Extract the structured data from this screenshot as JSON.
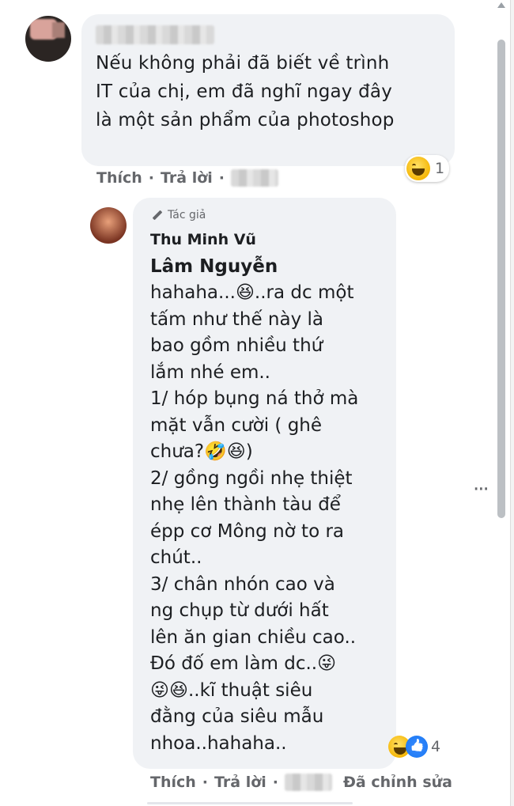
{
  "comment1": {
    "author": "",
    "text": "Nếu không phải đã biết về trình\nIT của chị, em đã nghĩ ngay đây\nlà một sản phẩm của photoshop",
    "reaction_count": "1",
    "actions": {
      "like": "Thích",
      "reply": "Trả lời",
      "sep": "·"
    }
  },
  "reply": {
    "badge": "Tác giả",
    "author": "Thu Minh Vũ",
    "tag": "Lâm Nguyễn",
    "text": "hahaha...😆..ra dc một\ntấm như thế này là\nbao gồm nhiều thứ\nlắm nhé em..\n1/ hóp bụng ná thở mà\nmặt vẫn cười ( ghê\nchưa?🤣😆)\n2/ gồng ngồi nhẹ thiệt\nnhẹ lên thành tàu để\népp cơ Mông nờ to ra\nchút..\n3/ chân nhón cao và\nng chụp từ dưới hất\nlên ăn gian chiều cao..\nĐó đố em làm dc..😜\n😜😆..kĩ thuật siêu\nđằng của siêu mẫu\nnhoa..hahaha..",
    "reaction_count": "4",
    "actions": {
      "like": "Thích",
      "reply": "Trả lời",
      "sep": "·",
      "edited": "Đã chỉnh sửa"
    }
  },
  "icons": [
    "pencil-icon",
    "haha-reaction-icon",
    "like-reaction-icon",
    "more-options-icon",
    "scroll-up-icon"
  ]
}
